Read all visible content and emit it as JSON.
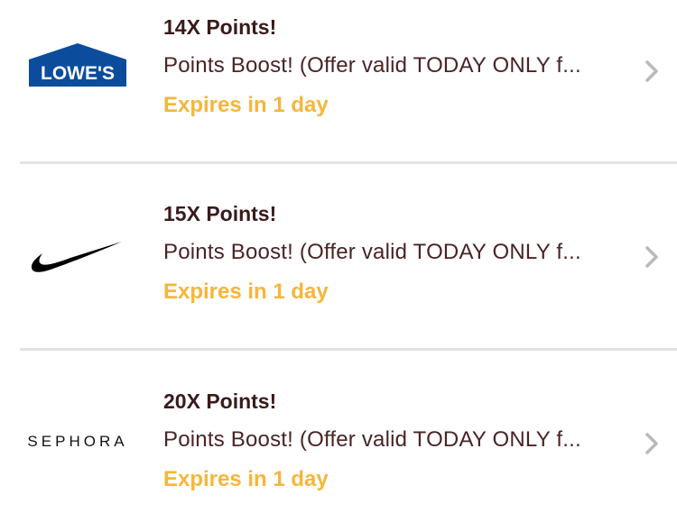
{
  "offers": [
    {
      "brand": "Lowe's",
      "logo_text": "LOWE'S",
      "logo_color": "#0b4c9c",
      "title": "14X Points!",
      "description": "Points Boost! (Offer valid TODAY ONLY f...",
      "expiry": "Expires in 1 day",
      "chevron_icon": "chevron-right-icon"
    },
    {
      "brand": "Nike",
      "logo_icon": "nike-swoosh-icon",
      "title": "15X Points!",
      "description": "Points Boost! (Offer valid TODAY ONLY f...",
      "expiry": "Expires in 1 day",
      "chevron_icon": "chevron-right-icon"
    },
    {
      "brand": "Sephora",
      "logo_text": "SEPHORA",
      "title": "20X Points!",
      "description": "Points Boost! (Offer valid TODAY ONLY f...",
      "expiry": "Expires in 1 day",
      "chevron_icon": "chevron-right-icon"
    }
  ],
  "colors": {
    "title": "#3a1a1a",
    "description": "#4a2424",
    "expiry": "#f5b63a",
    "divider": "#e3e3e3",
    "chevron": "#b9b9b9"
  }
}
